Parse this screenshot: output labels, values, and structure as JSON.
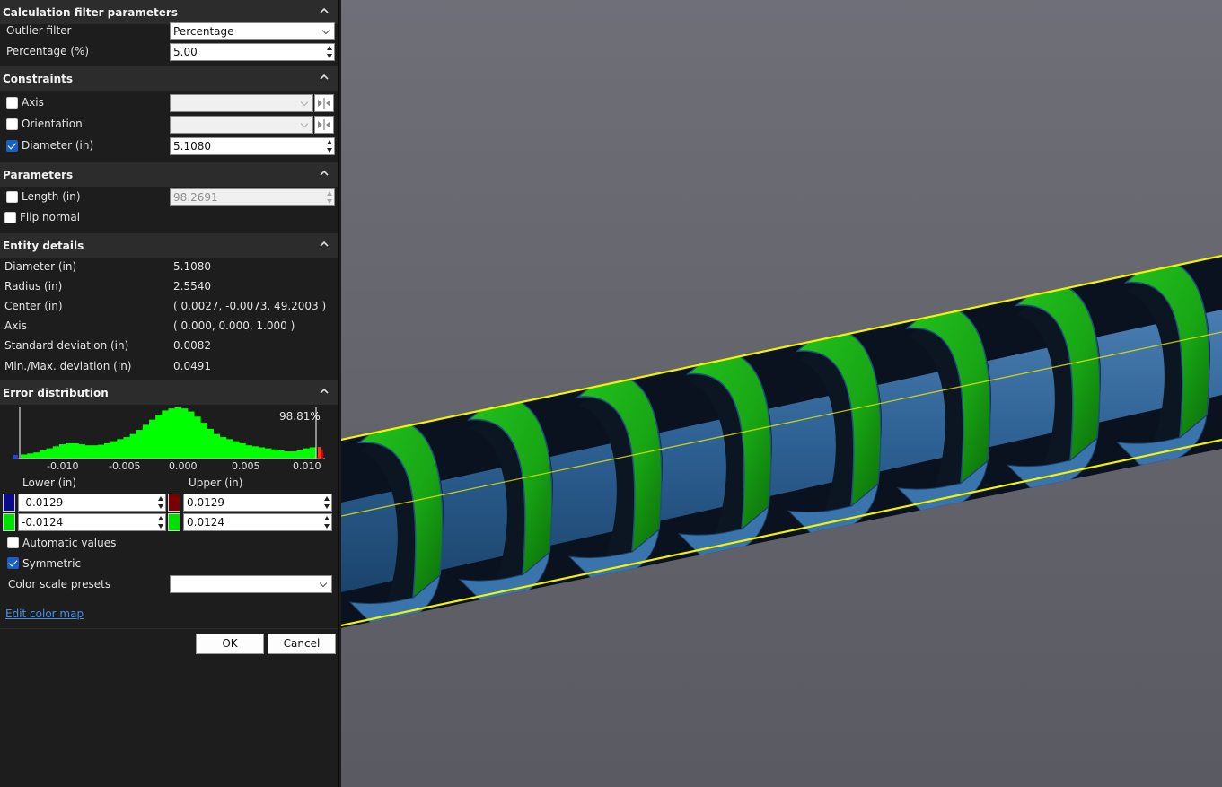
{
  "filter": {
    "title": "Calculation filter parameters",
    "outlier_label": "Outlier filter",
    "outlier_value": "Percentage",
    "percentage_label": "Percentage (%)",
    "percentage_value": "5.00"
  },
  "constraints": {
    "title": "Constraints",
    "axis_label": "Axis",
    "axis_checked": false,
    "orientation_label": "Orientation",
    "orientation_checked": false,
    "diameter_label": "Diameter (in)",
    "diameter_checked": true,
    "diameter_value": "5.1080"
  },
  "parameters": {
    "title": "Parameters",
    "length_label": "Length (in)",
    "length_value": "98.2691",
    "flip_label": "Flip normal"
  },
  "entity": {
    "title": "Entity details",
    "rows": [
      {
        "label": "Diameter (in)",
        "value": "5.1080"
      },
      {
        "label": "Radius (in)",
        "value": "2.5540"
      },
      {
        "label": "Center (in)",
        "value": "( 0.0027, -0.0073, 49.2003 )"
      },
      {
        "label": "Axis",
        "value": "( 0.000, 0.000, 1.000 )"
      },
      {
        "label": "Standard deviation (in)",
        "value": "0.0082"
      },
      {
        "label": "Min./Max. deviation (in)",
        "value": "0.0491"
      }
    ]
  },
  "distribution": {
    "title": "Error distribution",
    "percent_label": "98.81%",
    "ticks": [
      "-0.010",
      "-0.005",
      "0.000",
      "0.005",
      "0.010"
    ],
    "lower_label": "Lower (in)",
    "upper_label": "Upper (in)",
    "lower_outer": "-0.0129",
    "lower_inner": "-0.0124",
    "upper_outer": "0.0129",
    "upper_inner": "0.0124",
    "auto_label": "Automatic values",
    "symmetric_label": "Symmetric",
    "presets_label": "Color scale presets",
    "edit_link": "Edit color map",
    "colors": {
      "lower_outer": "#0a0a8a",
      "lower_inner": "#00e000",
      "upper_outer": "#7a0000",
      "upper_inner": "#00e000",
      "histogram": "#00ff00"
    }
  },
  "chart_data": {
    "type": "bar",
    "x_range": [
      -0.0129,
      0.0129
    ],
    "x_ticks": [
      -0.01,
      -0.005,
      0.0,
      0.005,
      0.01
    ],
    "bins_relative": [
      0.08,
      0.1,
      0.12,
      0.16,
      0.2,
      0.24,
      0.28,
      0.3,
      0.3,
      0.28,
      0.26,
      0.26,
      0.27,
      0.3,
      0.34,
      0.38,
      0.42,
      0.48,
      0.56,
      0.66,
      0.76,
      0.86,
      0.94,
      0.98,
      1.0,
      0.98,
      0.92,
      0.82,
      0.7,
      0.58,
      0.48,
      0.42,
      0.38,
      0.34,
      0.3,
      0.26,
      0.24,
      0.22,
      0.2,
      0.18,
      0.16,
      0.14,
      0.14,
      0.16,
      0.2,
      0.22
    ]
  },
  "buttons": {
    "ok": "OK",
    "cancel": "Cancel"
  }
}
